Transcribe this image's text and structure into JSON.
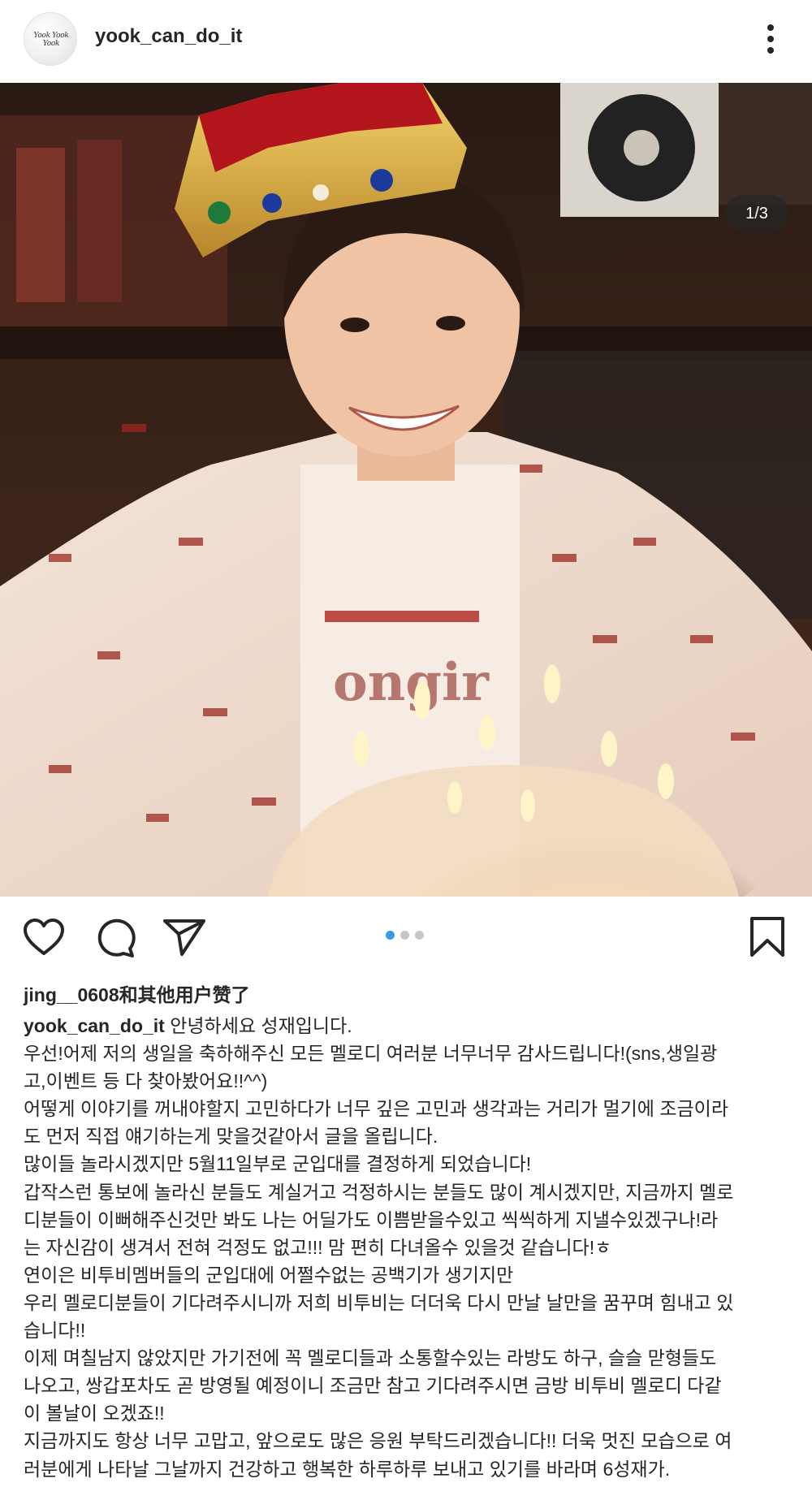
{
  "header": {
    "avatar_text": "Yook Yook Yook",
    "username": "yook_can_do_it",
    "more_icon": "more-vertical-icon"
  },
  "photo": {
    "counter": "1/3",
    "description_icon": "birthday-photo"
  },
  "actions": {
    "like_icon": "heart-icon",
    "comment_icon": "comment-icon",
    "share_icon": "send-icon",
    "save_icon": "bookmark-icon",
    "carousel_total": 3,
    "carousel_active": 1,
    "active_dot_color": "#3897f0"
  },
  "likes": {
    "user": "jing__0608",
    "text": "和其他用户赞了"
  },
  "caption": {
    "user": "yook_can_do_it",
    "first_line": " 안녕하세요 성재입니다.",
    "lines": [
      "우선!어제 저의 생일을 축하해주신 모든 멜로디 여러분 너무너무 감사드립니다!(sns,생일광",
      "고,이벤트 등 다 찾아봤어요!!^^)",
      "어떻게 이야기를 꺼내야할지 고민하다가 너무 깊은 고민과 생각과는 거리가 멀기에 조금이라",
      "도 먼저 직접 얘기하는게 맞을것같아서 글을 올립니다.",
      "많이들 놀라시겠지만 5월11일부로 군입대를 결정하게 되었습니다!",
      "갑작스런 통보에 놀라신 분들도 계실거고 걱정하시는 분들도 많이 계시겠지만, 지금까지 멜로",
      "디분들이 이뻐해주신것만 봐도 나는 어딜가도 이쁨받을수있고 씩씩하게 지낼수있겠구나!라",
      "는 자신감이 생겨서 전혀 걱정도 없고!!! 맘 편히 다녀올수 있을것 같습니다!ㅎ",
      "연이은 비투비멤버들의 군입대에 어쩔수없는 공백기가 생기지만",
      "우리 멜로디분들이 기다려주시니까 저희 비투비는 더더욱 다시 만날 날만을 꿈꾸며 힘내고 있",
      "습니다!!",
      "이제 며칠남지 않았지만 가기전에 꼭 멜로디들과 소통할수있는 라방도 하구, 슬슬 맏형들도",
      "나오고, 쌍갑포차도 곧 방영될 예정이니 조금만 참고 기다려주시면 금방 비투비 멜로디 다같",
      "이 볼날이 오겠죠!!",
      "지금까지도 항상 너무 고맙고, 앞으로도 많은 응원 부탁드리겠습니다!! 더욱 멋진 모습으로 여",
      "러분에게 나타날 그날까지 건강하고 행복한 하루하루 보내고 있기를 바라며 6성재가."
    ]
  }
}
